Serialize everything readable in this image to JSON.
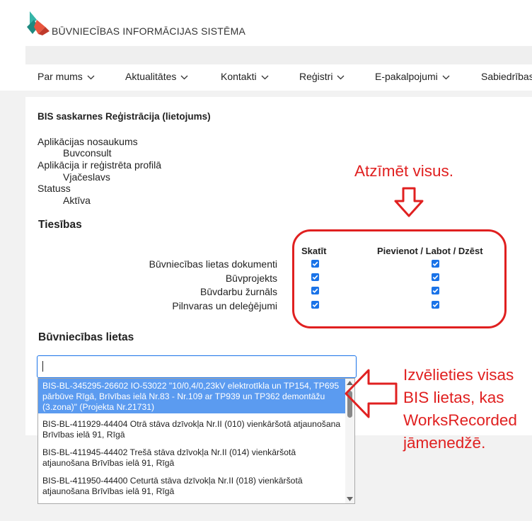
{
  "header": {
    "brand": "BŪVNIECĪBAS INFORMĀCIJAS SISTĒMA",
    "nav": [
      "Par mums",
      "Aktualitātes",
      "Kontakti",
      "Reģistri",
      "E-pakalpojumi",
      "Sabiedrības"
    ]
  },
  "form": {
    "title": "BIS saskarnes Reģistrācija (lietojums)",
    "app_name_label": "Aplikācijas nosaukums",
    "app_name_value": "Buvconsult",
    "profile_label": "Aplikācija ir reģistrēta profilā",
    "profile_value": "Vjačeslavs",
    "status_label": "Statuss",
    "status_value": "Aktīva",
    "rights_heading": "Tiesības",
    "col_view": "Skatīt",
    "col_edit": "Pievienot / Labot / Dzēst",
    "permissions": [
      {
        "label": "Būvniecības lietas dokumenti",
        "view": true,
        "edit": true
      },
      {
        "label": "Būvprojekts",
        "view": true,
        "edit": true
      },
      {
        "label": "Būvdarbu žurnāls",
        "view": true,
        "edit": true
      },
      {
        "label": "Pilnvaras un deleģējumi",
        "view": true,
        "edit": true
      }
    ],
    "cases_heading": "Būvniecības lietas",
    "search_value": ""
  },
  "dropdown_options": [
    {
      "text": "BIS-BL-345295-26602 IO-53022 \"10/0,4/0,23kV elektrotīkla un TP154, TP695 pārbūve Rīgā, Brīvības ielā Nr.83 - Nr.109 ar TP939 un TP362 demontāžu (3.zona)\" (Projekta Nr.21731)",
      "selected": true
    },
    {
      "text": "BIS-BL-411929-44404 Otrā stāva dzīvokļa Nr.II (010) vienkāršotā atjaunošana Brīvības ielā 91, Rīgā",
      "selected": false
    },
    {
      "text": "BIS-BL-411945-44402 Trešā stāva dzīvokļa Nr.II (014) vienkāršotā atjaunošana Brīvības ielā 91, Rīgā",
      "selected": false
    },
    {
      "text": "BIS-BL-411950-44400 Ceturtā stāva dzīvokļa Nr.II (018) vienkāršotā atjaunošana Brīvības ielā 91, Rīgā",
      "selected": false
    }
  ],
  "annotations": {
    "top": "Atzīmēt visus.",
    "right": [
      "Izvēlieties visas",
      "BIS lietas, kas",
      "WorksRecorded",
      "jāmenedžē."
    ],
    "color": "#e02020"
  },
  "colors": {
    "accent": "#1a73e8",
    "selection": "#5b9bf0"
  }
}
